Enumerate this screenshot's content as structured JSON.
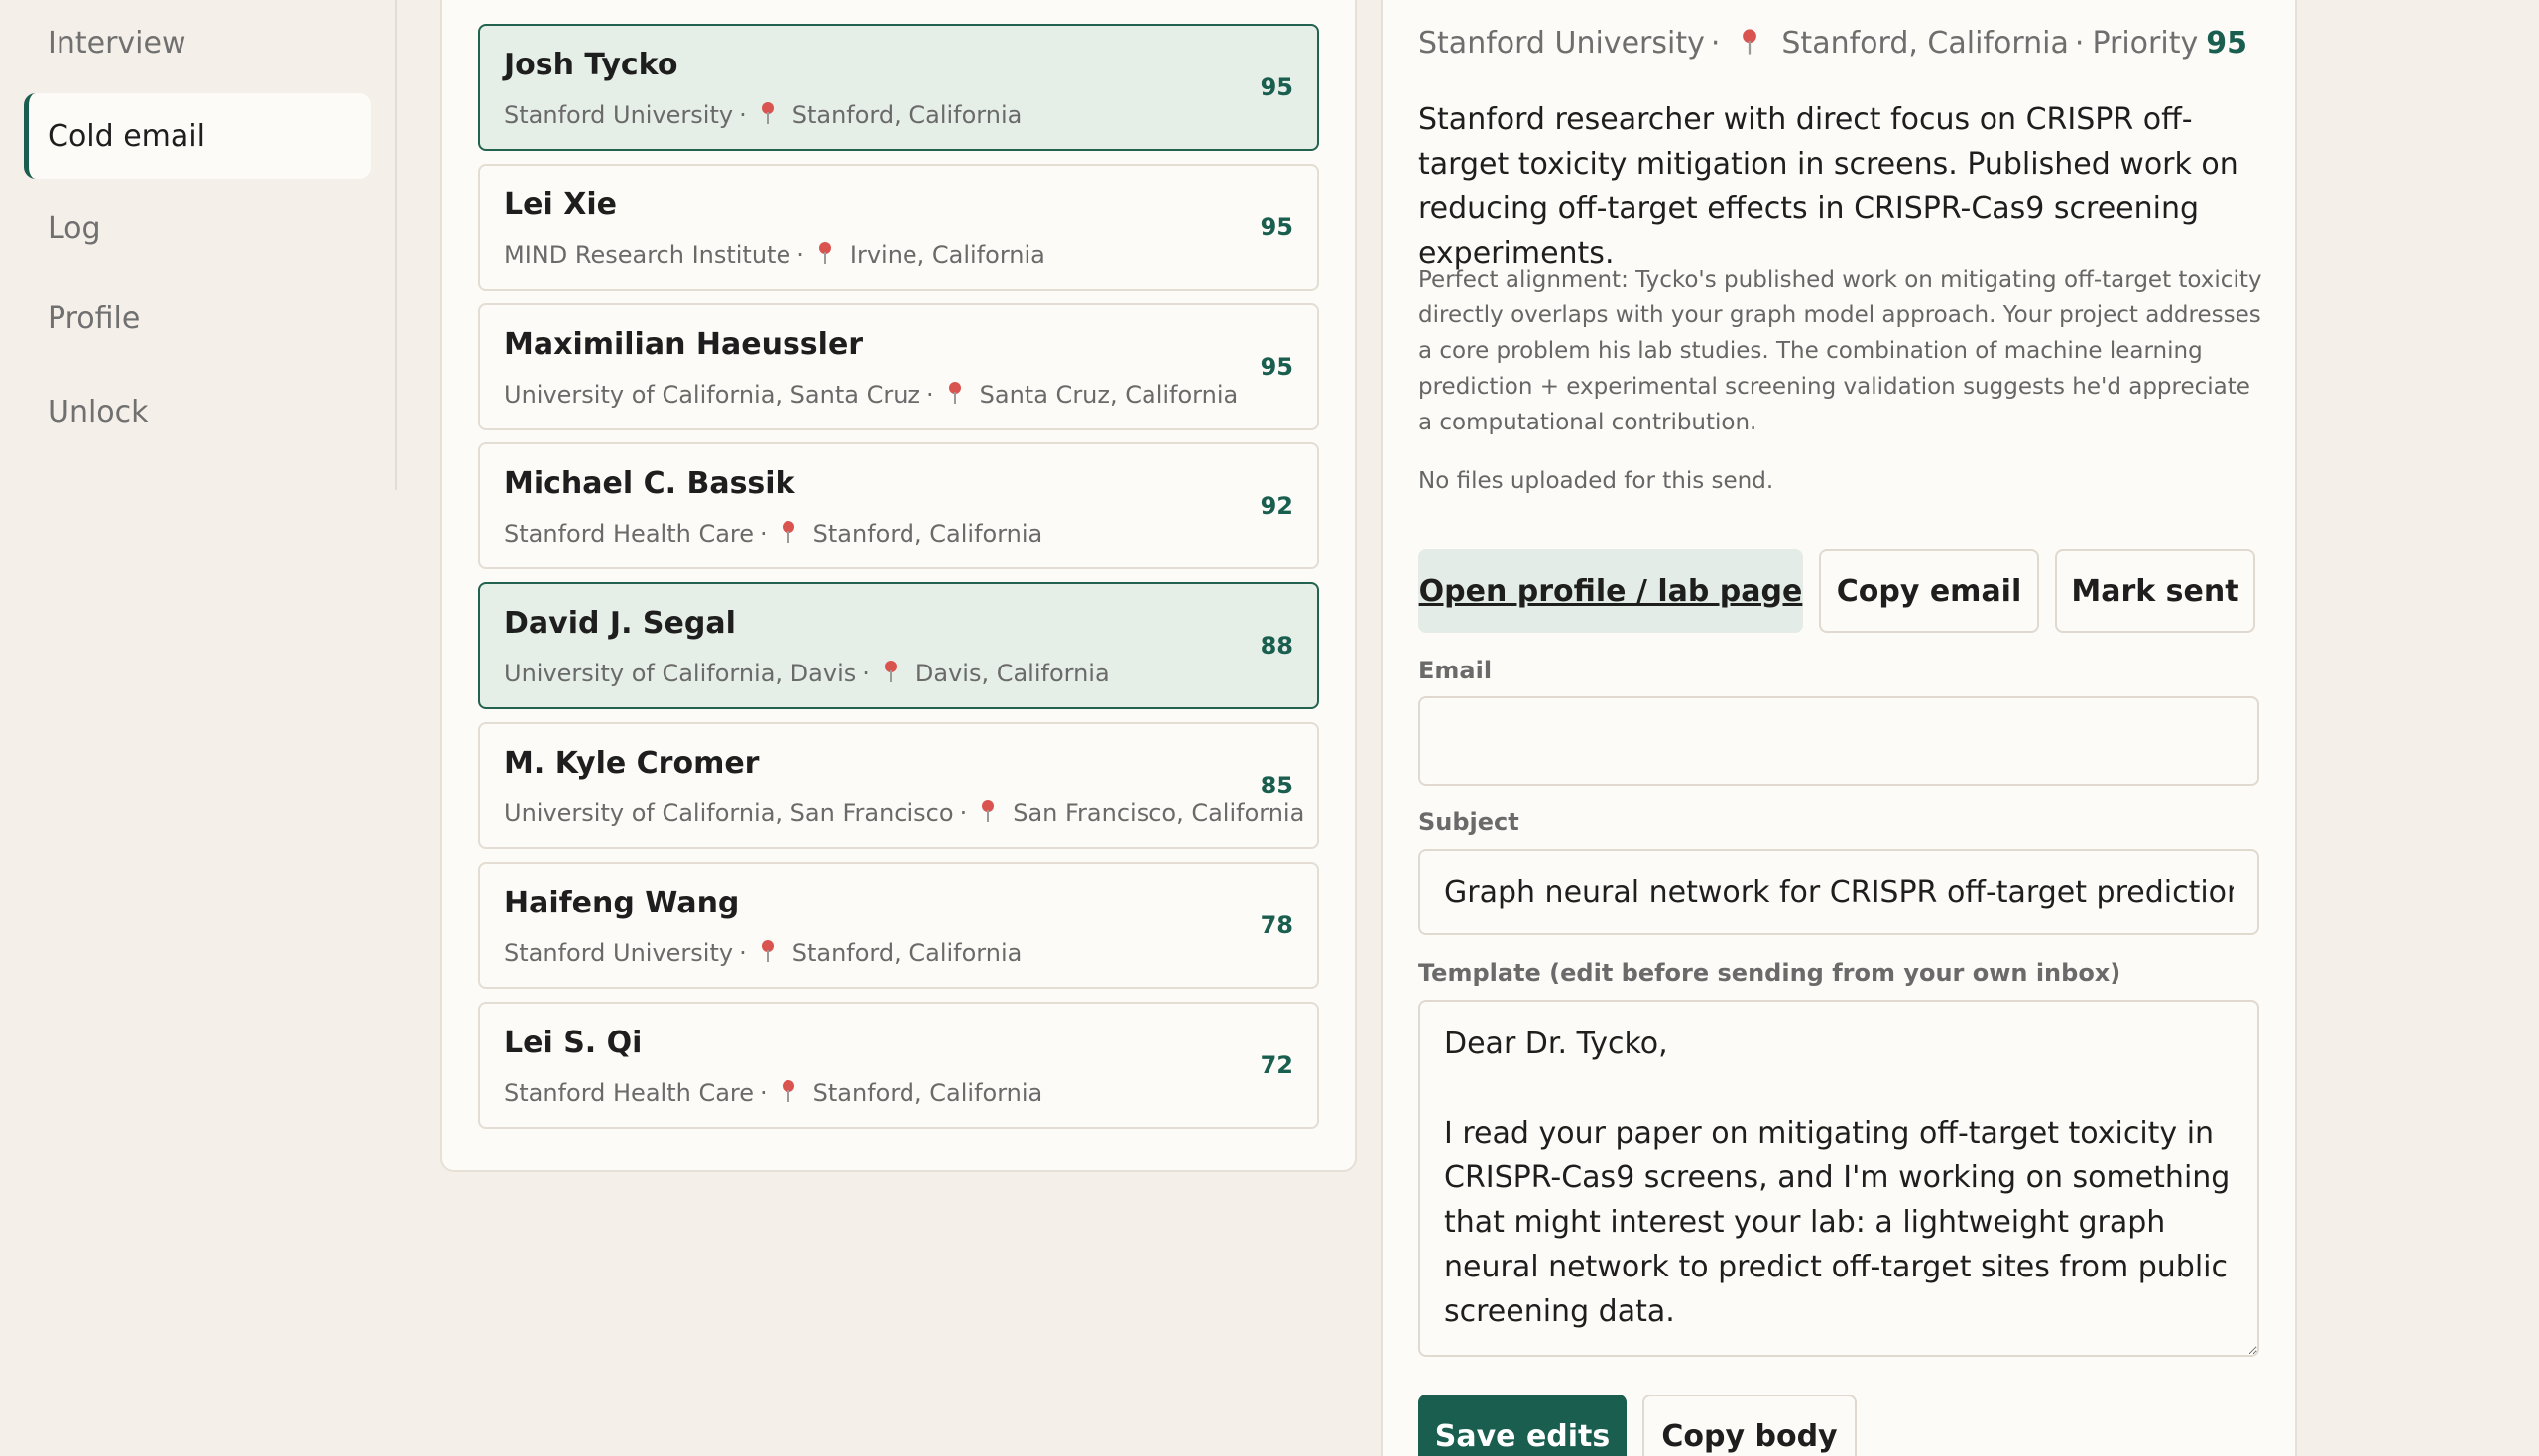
{
  "nav": {
    "items": [
      {
        "label": "Interview",
        "active": false
      },
      {
        "label": "Cold email",
        "active": true
      },
      {
        "label": "Log",
        "active": false
      },
      {
        "label": "Profile",
        "active": false
      },
      {
        "label": "Unlock",
        "active": false
      }
    ]
  },
  "contacts": [
    {
      "name": "Josh Tycko",
      "institution": "Stanford University",
      "location": "Stanford, California",
      "score": "95",
      "selected": true
    },
    {
      "name": "Lei Xie",
      "institution": "MIND Research Institute",
      "location": "Irvine, California",
      "score": "95",
      "selected": false
    },
    {
      "name": "Maximilian Haeussler",
      "institution": "University of California, Santa Cruz",
      "location": "Santa Cruz, California",
      "score": "95",
      "selected": false
    },
    {
      "name": "Michael C. Bassik",
      "institution": "Stanford Health Care",
      "location": "Stanford, California",
      "score": "92",
      "selected": false
    },
    {
      "name": "David J. Segal",
      "institution": "University of California, Davis",
      "location": "Davis, California",
      "score": "88",
      "selected": true
    },
    {
      "name": "M. Kyle Cromer",
      "institution": "University of California, San Francisco",
      "location": "San Francisco, California",
      "score": "85",
      "selected": false
    },
    {
      "name": "Haifeng Wang",
      "institution": "Stanford University",
      "location": "Stanford, California",
      "score": "78",
      "selected": false
    },
    {
      "name": "Lei S. Qi",
      "institution": "Stanford Health Care",
      "location": "Stanford, California",
      "score": "72",
      "selected": false
    }
  ],
  "detail": {
    "institution": "Stanford University",
    "location": "Stanford, California",
    "priority_label": "Priority",
    "priority": "95",
    "summary": "Stanford researcher with direct focus on CRISPR off-target toxicity mitigation in screens. Published work on reducing off-target effects in CRISPR-Cas9 screening experiments.",
    "rationale": "Perfect alignment: Tycko's published work on mitigating off-target toxicity directly overlaps with your graph model approach. Your project addresses a core problem his lab studies. The combination of machine learning prediction + experimental screening validation suggests he'd appreciate a computational contribution.",
    "files_note": "No files uploaded for this send.",
    "buttons": {
      "open_profile": "Open profile / lab page",
      "copy_email": "Copy email",
      "mark_sent": "Mark sent",
      "save_edits": "Save edits",
      "copy_body": "Copy body"
    },
    "email_label": "Email",
    "email_value": "",
    "subject_label": "Subject",
    "subject_value": "Graph neural network for CRISPR off-target prediction",
    "template_label": "Template (edit before sending from your own inbox)",
    "template_value": "Dear Dr. Tycko,\n\nI read your paper on mitigating off-target toxicity in CRISPR-Cas9 screens, and I'm working on something that might interest your lab: a lightweight graph neural network to predict off-target sites from public screening data."
  },
  "colors": {
    "accent": "#1a5e4f",
    "background": "#f4efe8",
    "panel": "#fdfbf7",
    "selected_card": "#e6eee8",
    "pin": "#d9534f"
  }
}
